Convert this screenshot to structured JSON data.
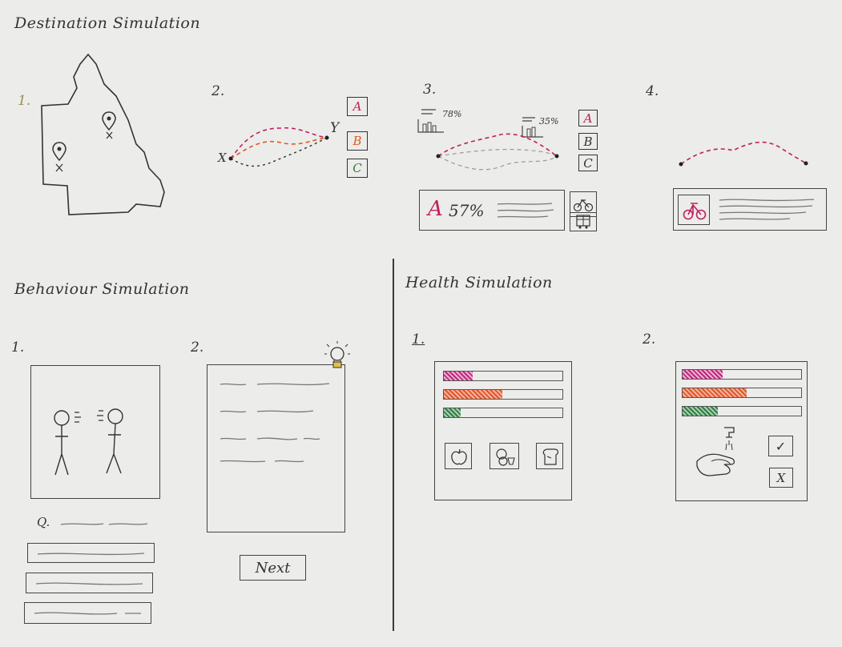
{
  "destination": {
    "title": "Destination Simulation",
    "steps": [
      "1.",
      "2.",
      "3.",
      "4."
    ],
    "route_options": [
      "A",
      "B",
      "C"
    ],
    "option_colors": {
      "A": "#c0205e",
      "B": "#e05a1f",
      "C": "#2f7d43"
    },
    "endpoints": {
      "start": "X",
      "end": "Y"
    },
    "stats": {
      "left": "78%",
      "right": "35%"
    },
    "result": {
      "option": "A",
      "percent": "57%"
    }
  },
  "behaviour": {
    "title": "Behaviour Simulation",
    "steps": [
      "1.",
      "2."
    ],
    "question_label": "Q.",
    "next_label": "Next"
  },
  "health": {
    "title": "Health Simulation",
    "steps": [
      "1.",
      "2."
    ],
    "screen1_levels": [
      0.24,
      0.49,
      0.14
    ],
    "screen2_levels": [
      0.34,
      0.54,
      0.3
    ],
    "accept_symbol": "✓",
    "reject_symbol": "X"
  },
  "icons": [
    "map-pin-icon",
    "bus-icon",
    "bike-icon",
    "car-icon",
    "lightbulb-icon",
    "apple-icon",
    "food-icon",
    "bread-icon",
    "hand-wash-icon"
  ]
}
